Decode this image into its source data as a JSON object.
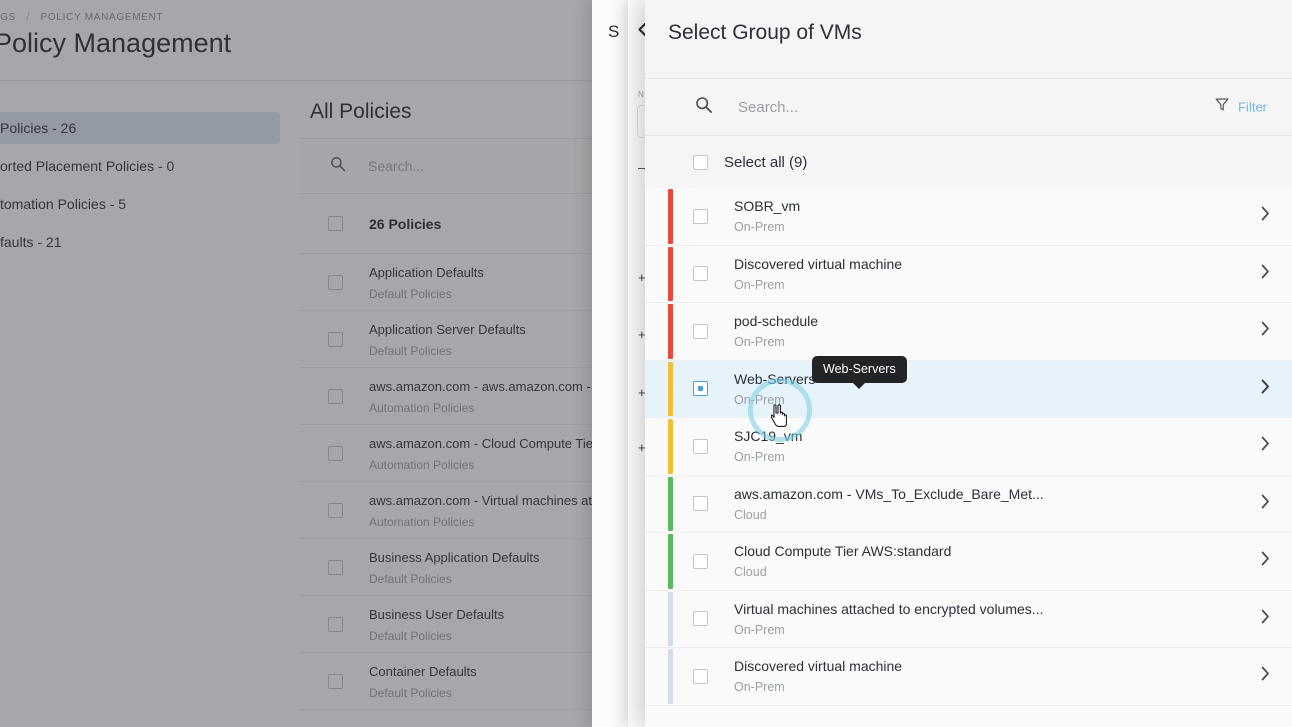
{
  "background": {
    "breadcrumb": {
      "parent": "TINGS",
      "separator": "/",
      "current": "POLICY MANAGEMENT"
    },
    "page_title": "Policy Management",
    "facets": [
      {
        "label": "Policies - 26",
        "active": true
      },
      {
        "label": "orted Placement Policies - 0",
        "active": false
      },
      {
        "label": "tomation Policies - 5",
        "active": false
      },
      {
        "label": "faults - 21",
        "active": false
      }
    ],
    "policies_panel": {
      "title": "All Policies",
      "search_placeholder": "Search...",
      "search_icon": "search-icon",
      "count_label": "26 Policies",
      "rows": [
        {
          "name": "Application Defaults",
          "sub": "Default Policies"
        },
        {
          "name": "Application Server Defaults",
          "sub": "Default Policies"
        },
        {
          "name": "aws.amazon.com - aws.amazon.com - VM",
          "sub": "Automation Policies"
        },
        {
          "name": "aws.amazon.com - Cloud Compute Tier A",
          "sub": "Automation Policies"
        },
        {
          "name": "aws.amazon.com - Virtual machines attac",
          "sub": "Automation Policies"
        },
        {
          "name": "Business Application Defaults",
          "sub": "Default Policies"
        },
        {
          "name": "Business User Defaults",
          "sub": "Default Policies"
        },
        {
          "name": "Container Defaults",
          "sub": "Default Policies"
        }
      ]
    }
  },
  "peek_panels": {
    "panel_a_title": "S",
    "panel_b_back_icon": "chevron-left-icon",
    "panel_b_label": "N",
    "panel_b_plus_icon": "plus-icon"
  },
  "modal": {
    "title": "Select Group of VMs",
    "search_placeholder": "Search...",
    "search_icon": "search-icon",
    "filter_icon": "filter-funnel-icon",
    "filter_label": "Filter",
    "filter_color": "#6fb8ea",
    "select_all_label": "Select all (9)",
    "row_chevron_icon": "chevron-right-icon",
    "selected_row_bg": "#e7f3fa",
    "rows": [
      {
        "name": "SOBR_vm",
        "sub": "On-Prem",
        "bar": "#e8493a",
        "selected": false,
        "checkbox": "unchecked"
      },
      {
        "name": "Discovered virtual machine",
        "sub": "On-Prem",
        "bar": "#e8493a",
        "selected": false,
        "checkbox": "unchecked"
      },
      {
        "name": "pod-schedule",
        "sub": "On-Prem",
        "bar": "#e8493a",
        "selected": false,
        "checkbox": "unchecked"
      },
      {
        "name": "Web-Servers",
        "sub": "On-Prem",
        "bar": "#f0c138",
        "selected": true,
        "checkbox": "partial"
      },
      {
        "name": "SJC19_vm",
        "sub": "On-Prem",
        "bar": "#f0c138",
        "selected": false,
        "checkbox": "unchecked"
      },
      {
        "name": "aws.amazon.com - VMs_To_Exclude_Bare_Met...",
        "sub": "Cloud",
        "bar": "#5cb85c",
        "selected": false,
        "checkbox": "unchecked"
      },
      {
        "name": "Cloud Compute Tier AWS:standard",
        "sub": "Cloud",
        "bar": "#5cb85c",
        "selected": false,
        "checkbox": "unchecked"
      },
      {
        "name": "Virtual machines attached to encrypted volumes...",
        "sub": "On-Prem",
        "bar": "#d3dcee",
        "selected": false,
        "checkbox": "unchecked"
      },
      {
        "name": "Discovered virtual machine",
        "sub": "On-Prem",
        "bar": "#d3dcee",
        "selected": false,
        "checkbox": "unchecked"
      }
    ]
  },
  "tooltip": {
    "text": "Web-Servers"
  },
  "cursor": {
    "icon": "hand-pointer-cursor"
  }
}
